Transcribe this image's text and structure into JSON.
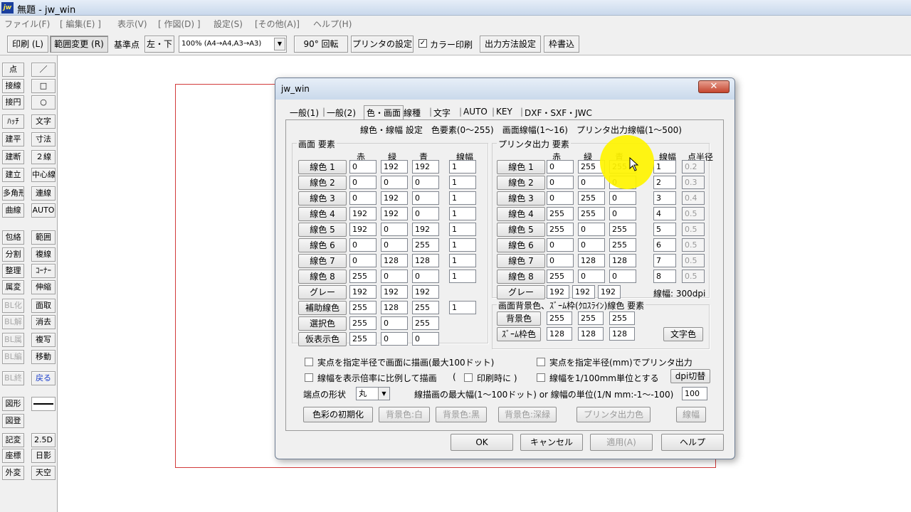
{
  "app": {
    "title": "無題 - jw_win",
    "logo": "jw"
  },
  "menu": [
    "ファイル(F)",
    "[ 編集(E) ]",
    "表示(V)",
    "[ 作図(D) ]",
    "設定(S)",
    "[その他(A)]",
    "ヘルプ(H)"
  ],
  "toolbar": {
    "print": "印刷 (L)",
    "range_change": "範囲変更 (R)",
    "base_point_label": "基準点",
    "base_point_value": "左・下",
    "scale_select": "100% (A4→A4,A3→A3)",
    "rotate": "90° 回転",
    "printer_settings": "プリンタの設定",
    "color_print": "カラー印刷",
    "output_method": "出力方法設定",
    "frame_write": "枠書込"
  },
  "left_tools": [
    [
      "点",
      "／"
    ],
    [
      "接線",
      "□"
    ],
    [
      "接円",
      "○"
    ],
    [
      "ﾊｯﾁ",
      "文字"
    ],
    [
      "建平",
      "寸法"
    ],
    [
      "建断",
      "２線"
    ],
    [
      "建立",
      "中心線"
    ],
    [
      "多角形",
      "連線"
    ],
    [
      "曲線",
      "AUTO"
    ],
    [
      "包絡",
      "範囲"
    ],
    [
      "分割",
      "複線"
    ],
    [
      "整理",
      "ｺｰﾅｰ"
    ],
    [
      "属変",
      "伸縮"
    ],
    [
      "BL化",
      "面取"
    ],
    [
      "BL解",
      "消去"
    ],
    [
      "BL属",
      "複写"
    ],
    [
      "BL編",
      "移動"
    ],
    [
      "BL終",
      "戻る"
    ],
    [
      "図形",
      ""
    ],
    [
      "図登",
      ""
    ],
    [
      "記変",
      "2.5D"
    ],
    [
      "座標",
      "日影"
    ],
    [
      "外変",
      "天空"
    ]
  ],
  "dialog": {
    "title": "jw_win",
    "close": "✕",
    "tabs": [
      "一般(1)",
      "一般(2)",
      "色・画面",
      "線種",
      "文字",
      "AUTO",
      "KEY",
      "DXF・SXF・JWC"
    ],
    "header": "線色・線幅 設定　色要素(0〜255)　画面線幅(1〜16)　プリンタ出力線幅(1〜500)",
    "screen": {
      "title": "画面 要素",
      "cols": [
        "赤",
        "緑",
        "青",
        "線幅"
      ],
      "rows": [
        {
          "label": "線色 1",
          "r": "0",
          "g": "192",
          "b": "192",
          "w": "1"
        },
        {
          "label": "線色 2",
          "r": "0",
          "g": "0",
          "b": "0",
          "w": "1"
        },
        {
          "label": "線色 3",
          "r": "0",
          "g": "192",
          "b": "0",
          "w": "1"
        },
        {
          "label": "線色 4",
          "r": "192",
          "g": "192",
          "b": "0",
          "w": "1"
        },
        {
          "label": "線色 5",
          "r": "192",
          "g": "0",
          "b": "192",
          "w": "1"
        },
        {
          "label": "線色 6",
          "r": "0",
          "g": "0",
          "b": "255",
          "w": "1"
        },
        {
          "label": "線色 7",
          "r": "0",
          "g": "128",
          "b": "128",
          "w": "1"
        },
        {
          "label": "線色 8",
          "r": "255",
          "g": "0",
          "b": "0",
          "w": "1"
        },
        {
          "label": "グレー",
          "r": "192",
          "g": "192",
          "b": "192",
          "w": ""
        },
        {
          "label": "補助線色",
          "r": "255",
          "g": "128",
          "b": "255",
          "w": "1"
        },
        {
          "label": "選択色",
          "r": "255",
          "g": "0",
          "b": "255",
          "w": ""
        },
        {
          "label": "仮表示色",
          "r": "255",
          "g": "0",
          "b": "0",
          "w": ""
        }
      ]
    },
    "printer": {
      "title": "プリンタ出力 要素",
      "cols": [
        "赤",
        "緑",
        "青",
        "線幅",
        "点半径"
      ],
      "rows": [
        {
          "label": "線色 1",
          "r": "0",
          "g": "255",
          "b": "255",
          "w": "1",
          "p": "0.2"
        },
        {
          "label": "線色 2",
          "r": "0",
          "g": "0",
          "b": "0",
          "w": "2",
          "p": "0.3"
        },
        {
          "label": "線色 3",
          "r": "0",
          "g": "255",
          "b": "0",
          "w": "3",
          "p": "0.4"
        },
        {
          "label": "線色 4",
          "r": "255",
          "g": "255",
          "b": "0",
          "w": "4",
          "p": "0.5"
        },
        {
          "label": "線色 5",
          "r": "255",
          "g": "0",
          "b": "255",
          "w": "5",
          "p": "0.5"
        },
        {
          "label": "線色 6",
          "r": "0",
          "g": "0",
          "b": "255",
          "w": "6",
          "p": "0.5"
        },
        {
          "label": "線色 7",
          "r": "0",
          "g": "128",
          "b": "128",
          "w": "7",
          "p": "0.5"
        },
        {
          "label": "線色 8",
          "r": "255",
          "g": "0",
          "b": "0",
          "w": "8",
          "p": "0.5"
        }
      ],
      "gray": {
        "label": "グレー",
        "r": "192",
        "g": "192",
        "b": "192"
      },
      "dpi_note": "線幅: 300dpi"
    },
    "background": {
      "title": "画面背景色、ｽﾞｰﾑ枠(ｸﾛｽﾗｲﾝ)線色 要素",
      "rows": [
        {
          "label": "背景色",
          "r": "255",
          "g": "255",
          "b": "255"
        },
        {
          "label": "ｽﾞｰﾑ枠色",
          "r": "128",
          "g": "128",
          "b": "128"
        }
      ],
      "text_color_button": "文字色"
    },
    "options": {
      "cb1": "実点を指定半径で画面に描画(最大100ドット)",
      "cb2": "実点を指定半径(mm)でプリンタ出力",
      "cb3": "線幅を表示倍率に比例して描画",
      "paren_open": "(",
      "cb_print": "印刷時に )",
      "cb4": "線幅を1/100mm単位とする",
      "dpi_button": "dpi切替",
      "endpoint_label": "端点の形状",
      "endpoint_value": "丸",
      "max_width_label": "線描画の最大幅(1〜100ドット) or 線幅の単位(1/N mm:-1〜-100)",
      "max_width_value": "100"
    },
    "buttons_row": {
      "init": "色彩の初期化",
      "bg_white": "背景色:白",
      "bg_black": "背景色:黒",
      "bg_dark": "背景色:深緑",
      "printer_color": "プリンタ出力色",
      "line_width": "線幅"
    },
    "footer": {
      "ok": "OK",
      "cancel": "キャンセル",
      "apply": "適用(A)",
      "help": "ヘルプ"
    }
  }
}
